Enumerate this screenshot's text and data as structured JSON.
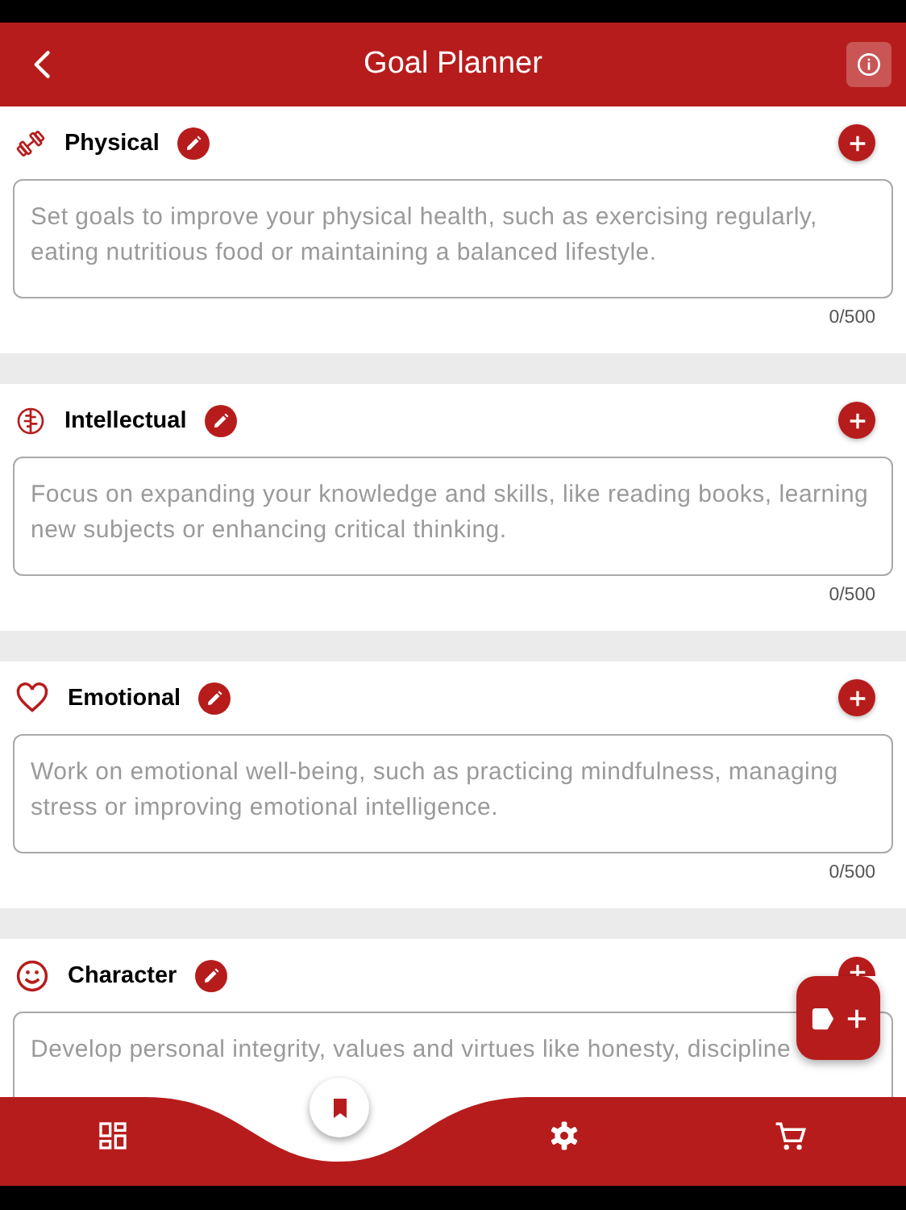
{
  "header": {
    "title": "Goal Planner"
  },
  "sections": [
    {
      "kind": "physical",
      "title": "Physical",
      "placeholder": "Set goals to improve your physical health, such as exercising regularly, eating nutritious food or maintaining a balanced lifestyle.",
      "counter": "0/500"
    },
    {
      "kind": "intellectual",
      "title": "Intellectual",
      "placeholder": "Focus on expanding your knowledge and skills, like reading books, learning new subjects or enhancing critical thinking.",
      "counter": "0/500"
    },
    {
      "kind": "emotional",
      "title": "Emotional",
      "placeholder": "Work on emotional well-being, such as practicing mindfulness, managing stress or improving emotional intelligence.",
      "counter": "0/500"
    },
    {
      "kind": "character",
      "title": "Character",
      "placeholder": "Develop personal integrity, values and virtues like honesty, discipline"
    }
  ]
}
